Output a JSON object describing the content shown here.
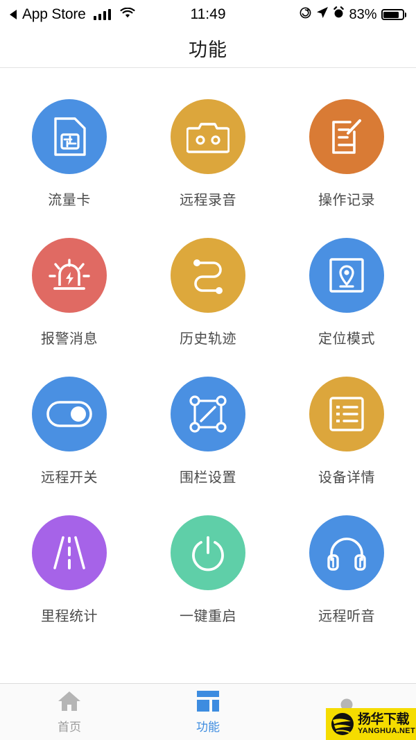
{
  "status_bar": {
    "back_label": "App Store",
    "time": "11:49",
    "battery_percent": "83%",
    "battery_level": 83,
    "icons": [
      "back-triangle-icon",
      "signal-bars-icon",
      "wifi-icon",
      "rotation-lock-icon",
      "location-arrow-icon",
      "alarm-clock-icon",
      "battery-icon"
    ]
  },
  "navbar": {
    "title": "功能"
  },
  "grid": {
    "items": [
      {
        "label": "流量卡",
        "icon": "sim-card-icon",
        "color": "#4a90e2"
      },
      {
        "label": "远程录音",
        "icon": "cassette-recorder-icon",
        "color": "#dca63c"
      },
      {
        "label": "操作记录",
        "icon": "document-edit-icon",
        "color": "#d97b35"
      },
      {
        "label": "报警消息",
        "icon": "alarm-siren-icon",
        "color": "#e06a63"
      },
      {
        "label": "历史轨迹",
        "icon": "route-track-icon",
        "color": "#dda83c"
      },
      {
        "label": "定位模式",
        "icon": "location-pin-frame-icon",
        "color": "#4a90e2"
      },
      {
        "label": "远程开关",
        "icon": "toggle-switch-icon",
        "color": "#4a90e2"
      },
      {
        "label": "围栏设置",
        "icon": "geofence-icon",
        "color": "#4a90e2"
      },
      {
        "label": "设备详情",
        "icon": "list-details-icon",
        "color": "#dca63c"
      },
      {
        "label": "里程统计",
        "icon": "road-icon",
        "color": "#a663e8"
      },
      {
        "label": "一键重启",
        "icon": "power-button-icon",
        "color": "#5fcfa8"
      },
      {
        "label": "远程听音",
        "icon": "headphones-icon",
        "color": "#4a90e2"
      }
    ]
  },
  "tabbar": {
    "tabs": [
      {
        "label": "首页",
        "icon": "home-icon",
        "active": false
      },
      {
        "label": "功能",
        "icon": "grid-icon",
        "active": true
      },
      {
        "label": "",
        "icon": "person-icon",
        "active": false
      }
    ],
    "active_color": "#3d8ce0",
    "inactive_color": "#9b9b9b"
  },
  "watermark": {
    "cn_text": "扬华下载",
    "en_text": "YANGHUA.NET",
    "background": "#f5dc00"
  }
}
